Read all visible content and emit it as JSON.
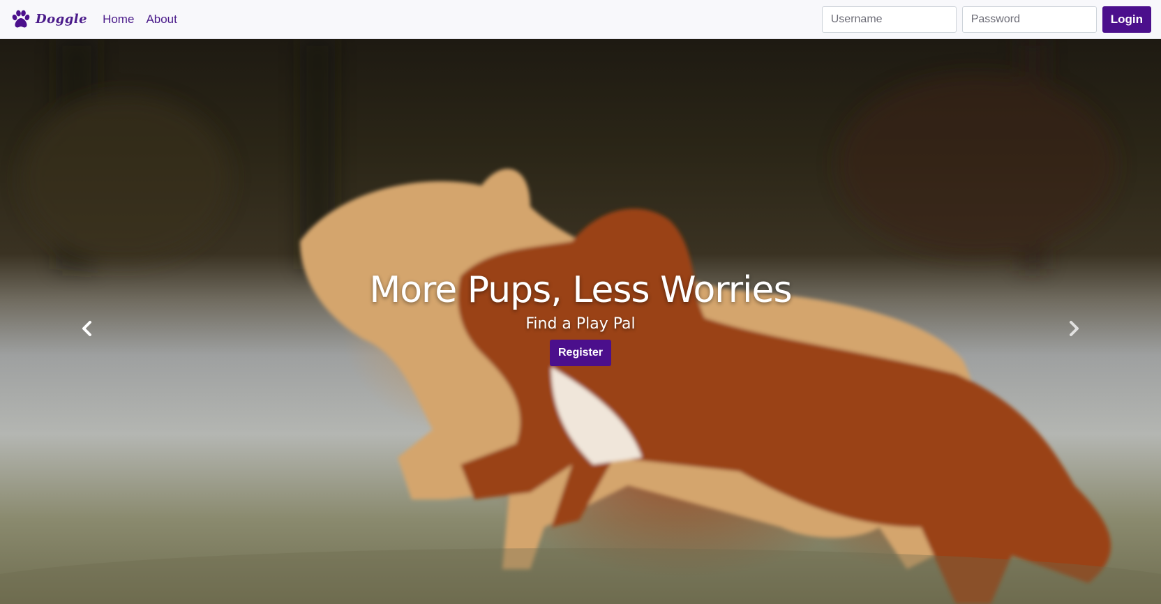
{
  "navbar": {
    "brand": "Doggle",
    "links": [
      "Home",
      "About"
    ],
    "username_placeholder": "Username",
    "password_placeholder": "Password",
    "login_label": "Login"
  },
  "hero": {
    "title": "More Pups, Less Worries",
    "subtitle": "Find a Play Pal",
    "register_label": "Register"
  },
  "carousel": {
    "prev_icon": "chevron-left-icon",
    "next_icon": "chevron-right-icon"
  },
  "colors": {
    "brand": "#4b0f8c",
    "nav_bg": "#f8f8fb"
  }
}
